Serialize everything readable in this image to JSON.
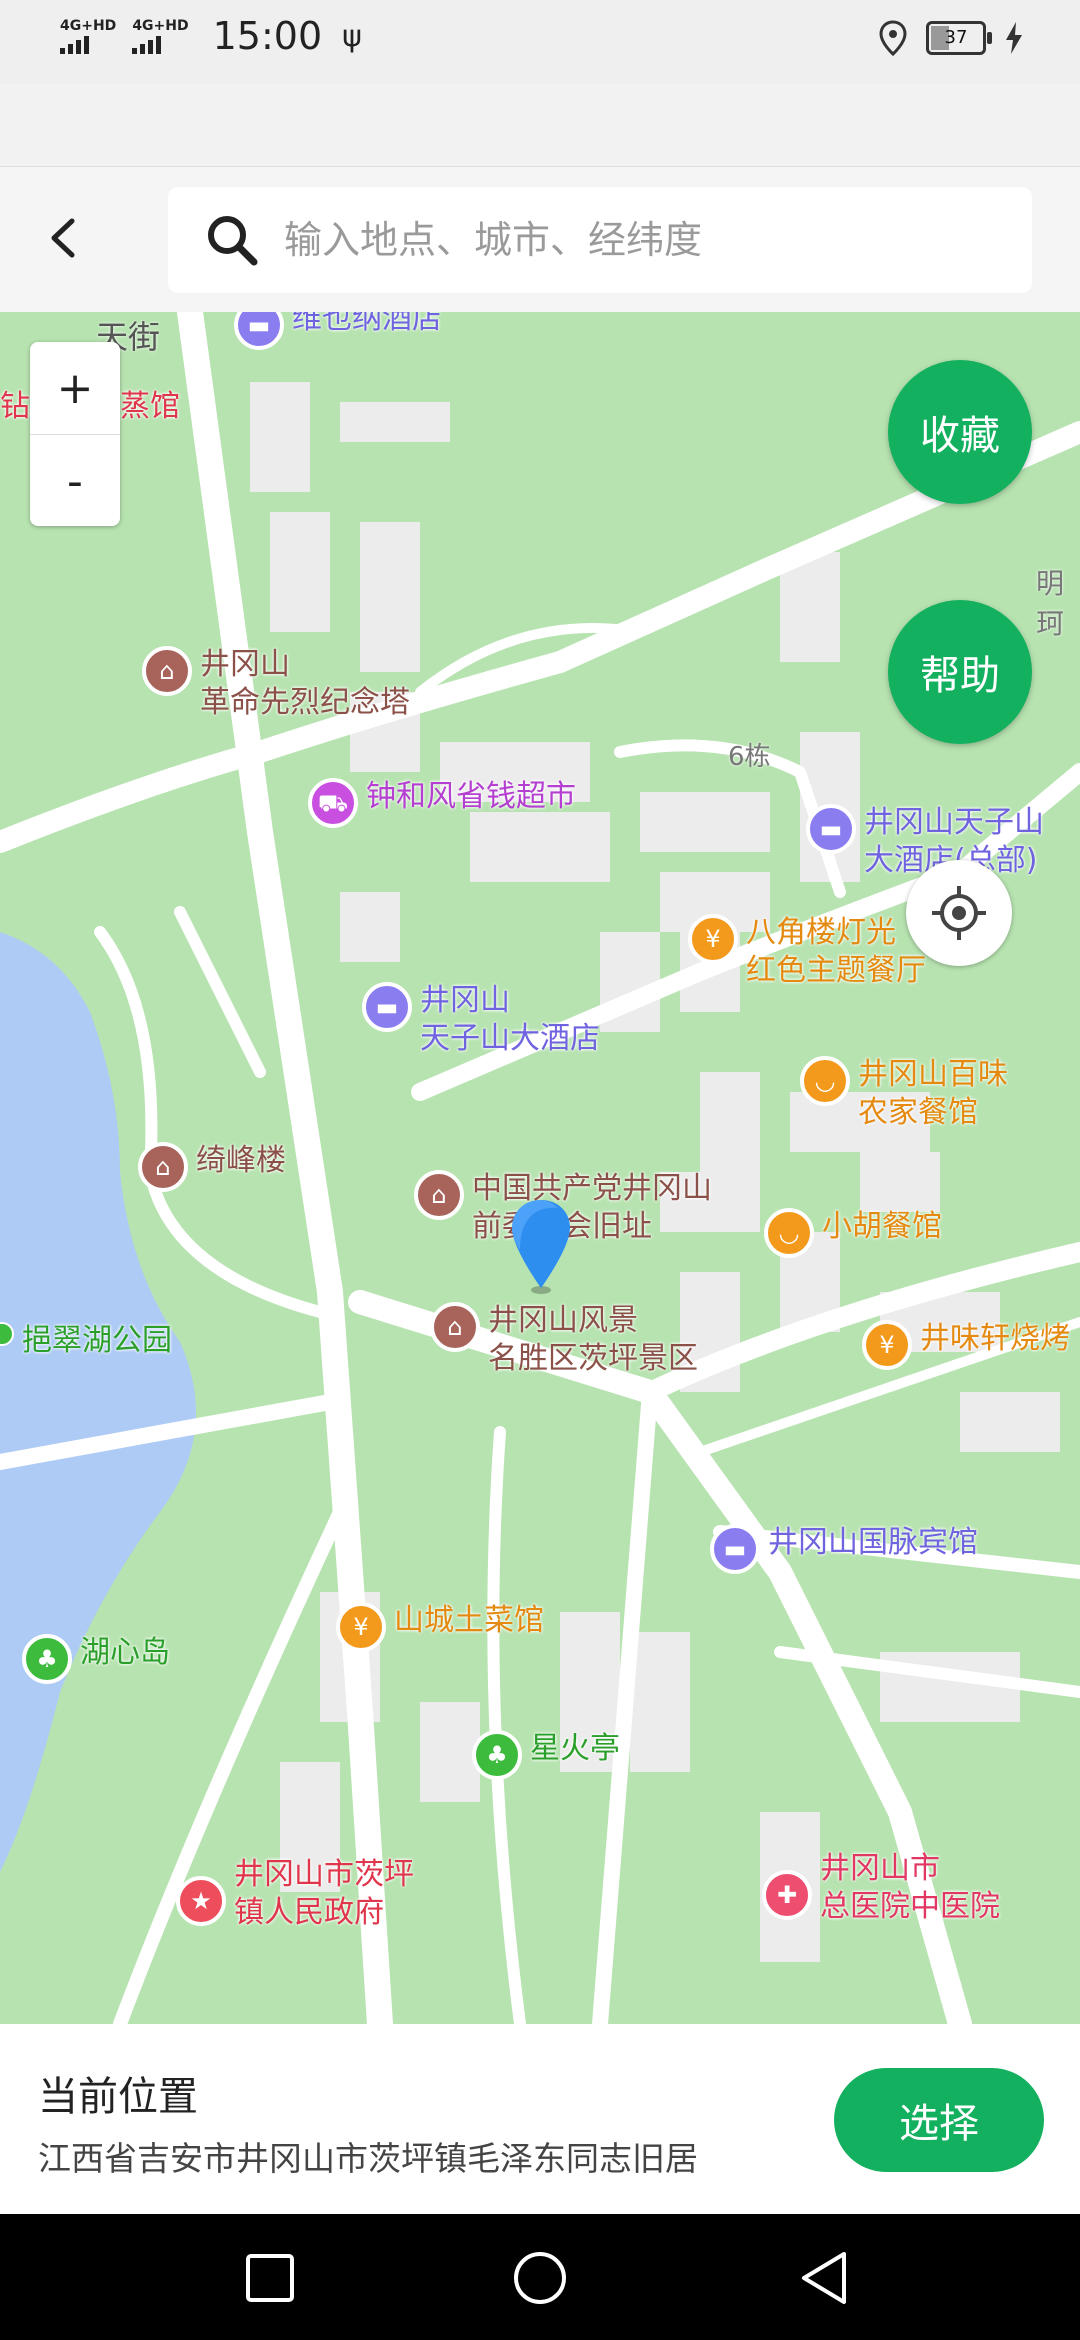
{
  "status_bar": {
    "signal_1": "4G+HD",
    "signal_2": "4G+HD",
    "time": "15:00",
    "battery": "37"
  },
  "header": {
    "search_placeholder": "输入地点、城市、经纬度"
  },
  "map": {
    "zoom_in": "+",
    "zoom_out": "-",
    "favorite_label": "收藏",
    "help_label": "帮助",
    "street_label": "天街",
    "building_label": "6栋",
    "edge_label": "明珂",
    "pois": {
      "hotel_vienna": "维也纳酒店",
      "medical_sauna": "钻中医熏蒸馆",
      "martyrs_tower": "井冈山\n革命先烈纪念塔",
      "zhonghefeng": "钟和风省钱超市",
      "tianzishan_hq": "井冈山天子山\n大酒店(总部)",
      "bajiaolou": "八角楼灯光\n红色主题餐厅",
      "tianzishan_hotel": "井冈山\n天子山大酒店",
      "baiwei": "井冈山百味\n农家餐馆",
      "qifenglou": "绮峰楼",
      "former_site": "中国共产党井冈山\n前委员会旧址",
      "xiaohu": "小胡餐馆",
      "scenic": "井冈山风景\n名胜区茨坪景区",
      "jingwei": "井味轩烧烤",
      "lake_park": "挹翠湖公园",
      "guomai": "井冈山国脉宾馆",
      "shancheng": "山城土菜馆",
      "lake_island": "湖心岛",
      "xinghuo": "星火亭",
      "town_gov": "井冈山市茨坪\n镇人民政府",
      "hospital": "井冈山市\n总医院中医院"
    }
  },
  "info": {
    "title": "当前位置",
    "address": "江西省吉安市井冈山市茨坪镇毛泽东同志旧居",
    "select_label": "选择"
  },
  "colors": {
    "accent": "#13b15f",
    "map_green": "#b7e3b0",
    "water": "#aecbf5"
  }
}
